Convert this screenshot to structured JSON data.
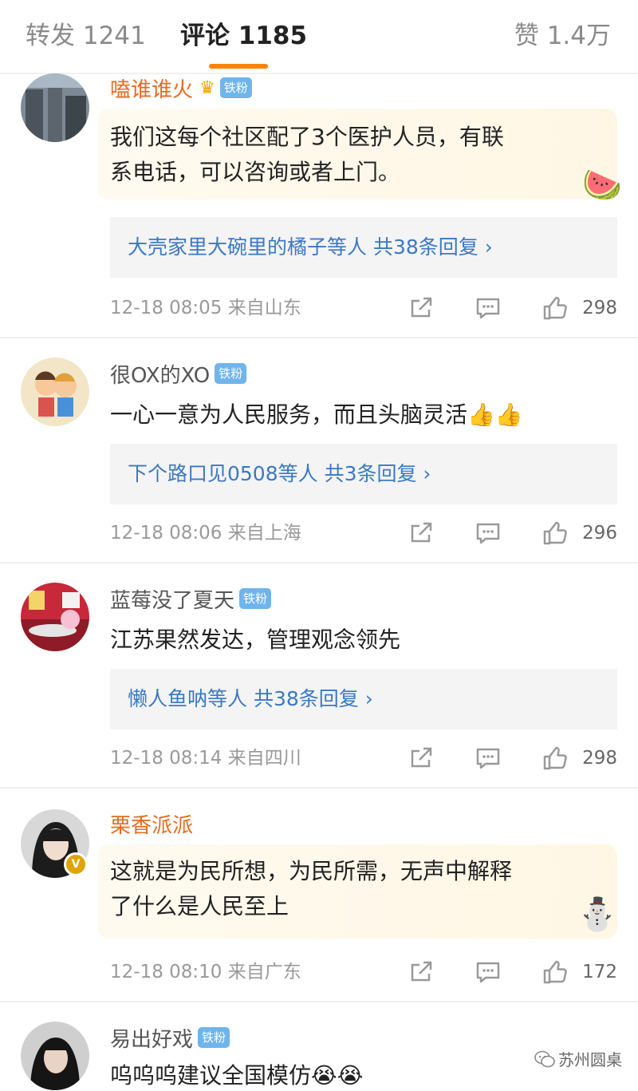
{
  "tabs": {
    "repost": "转发 1241",
    "comments": "评论 1185",
    "likes": "赞 1.4万"
  },
  "accent_color": "#ff8200",
  "link_color": "#3b78c4",
  "badge_color": "#6fb4ec",
  "comments": [
    {
      "username": "嗑谁谁火",
      "badge": "铁粉",
      "name_color": "#e86a1c",
      "text_lines": [
        "我们这每个社区配了3个医护人员，有联",
        "系电话，可以咨询或者上门。"
      ],
      "sticker_icon": "watermelon",
      "sticker": "🍉",
      "reply": "大壳家里大碗里的橘子等人  共38条回复 ›",
      "time_location": "12-18 08:05  来自山东",
      "likes": "298"
    },
    {
      "username": "很OX的XO",
      "badge": "铁粉",
      "name_color": "#555555",
      "text_lines": [
        "一心一意为人民服务，而且头脑灵活👍👍"
      ],
      "reply": "下个路口见0508等人  共3条回复 ›",
      "time_location": "12-18 08:06  来自上海",
      "likes": "296"
    },
    {
      "username": "蓝莓没了夏天",
      "badge": "铁粉",
      "name_color": "#555555",
      "text_lines": [
        "江苏果然发达，管理观念领先"
      ],
      "reply": "懒人鱼呐等人  共38条回复 ›",
      "time_location": "12-18 08:14  来自四川",
      "likes": "298"
    },
    {
      "username": "栗香派派",
      "name_color": "#e86a1c",
      "verified": "V",
      "text_lines": [
        "这就是为民所想，为民所需，无声中解释",
        "了什么是人民至上"
      ],
      "sticker_icon": "snowman",
      "sticker": "⛄",
      "time_location": "12-18 08:10  来自广东",
      "likes": "172"
    },
    {
      "username": "易出好戏",
      "badge": "铁粉",
      "name_color": "#555555",
      "text_lines": [
        "呜呜呜建议全国模仿😭😭"
      ]
    }
  ],
  "watermark": "苏州圆桌",
  "icons": [
    "share-icon",
    "comment-icon",
    "like-icon",
    "wechat-icon"
  ]
}
